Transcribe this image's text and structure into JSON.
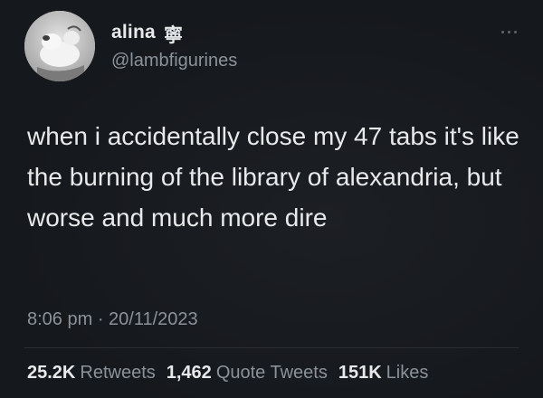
{
  "author": {
    "display_name": "alina",
    "name_symbol": "寧",
    "handle": "@lambfigurines",
    "avatar_icon": "lamb-figurine-avatar"
  },
  "menu": {
    "icon": "more-dots-icon"
  },
  "tweet": {
    "text": "when i accidentally close my 47 tabs it's like the burning of the library of alexandria, but worse and much more dire",
    "time": "8:06 pm · 20/11/2023"
  },
  "stats": {
    "retweets_count": "25.2K",
    "retweets_label": "Retweets",
    "quotes_count": "1,462",
    "quotes_label": "Quote Tweets",
    "likes_count": "151K",
    "likes_label": "Likes"
  },
  "colors": {
    "background": "#15181c",
    "text_primary": "#e7e9ea",
    "text_secondary": "#8b9299"
  }
}
